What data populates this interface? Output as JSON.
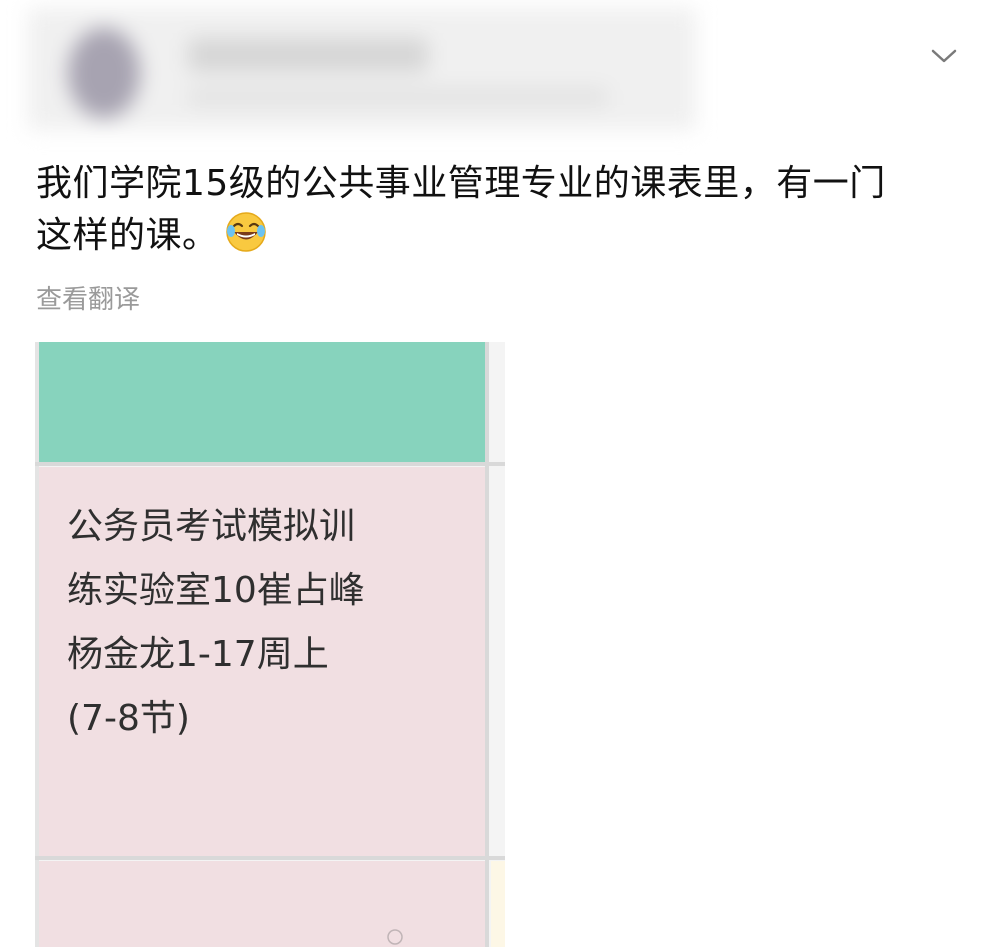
{
  "post": {
    "text_line1": "我们学院15级的公共事业管理专业的课表里，有一门",
    "text_line2": "这样的课。",
    "emoji": "laughing-tears-emoji",
    "translate_label": "查看翻译"
  },
  "header": {
    "menu_icon": "chevron-down-icon"
  },
  "timetable": {
    "course_text": "公务员考试模拟训\n练实验室10崔占峰\n杨金龙1-17周上\n(7-8节)",
    "colors": {
      "teal_cell": "#87d3bd",
      "pink_cell": "#f1dfe2",
      "cream_cell": "#fdf7e6",
      "grid": "#d9d9d9"
    }
  }
}
